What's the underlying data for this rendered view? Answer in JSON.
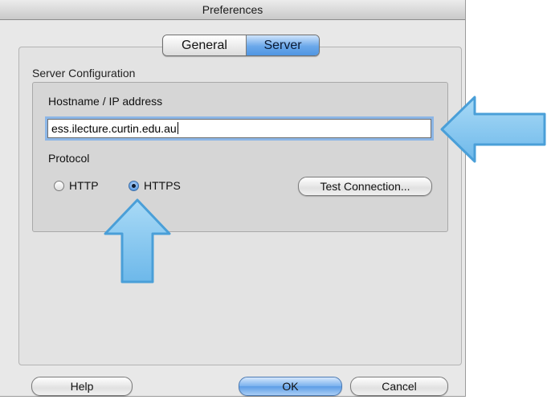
{
  "window": {
    "title": "Preferences"
  },
  "tabs": [
    {
      "label": "General",
      "selected": false
    },
    {
      "label": "Server",
      "selected": true
    }
  ],
  "server_configuration": {
    "group_label": "Server Configuration",
    "hostname_label": "Hostname / IP address",
    "hostname_value": "ess.ilecture.curtin.edu.au",
    "protocol_label": "Protocol",
    "protocol_options": [
      {
        "label": "HTTP",
        "selected": false
      },
      {
        "label": "HTTPS",
        "selected": true
      }
    ],
    "test_connection_label": "Test Connection..."
  },
  "footer": {
    "help_label": "Help",
    "ok_label": "OK",
    "cancel_label": "Cancel"
  },
  "annotations": {
    "arrow_color": "#7cc3ef",
    "arrow_border": "#4a9fd8"
  }
}
